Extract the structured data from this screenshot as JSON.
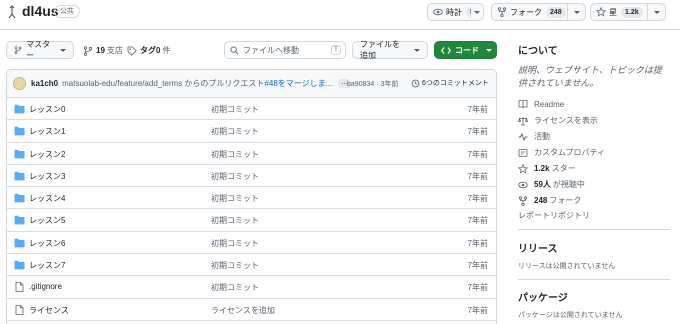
{
  "header": {
    "repo_name": "dl4us",
    "visibility": "公共",
    "watch": {
      "label": "時計",
      "count": "59"
    },
    "fork": {
      "label": "フォーク",
      "count": "248"
    },
    "star": {
      "label": "星",
      "count": "1.2k"
    }
  },
  "toolbar": {
    "branch_label": "マスター",
    "branches": {
      "count": "19",
      "label": "支店"
    },
    "tags": {
      "count": "タグ0",
      "label": "件"
    },
    "search_placeholder": "ファイルへ移動",
    "search_shortcut": "T",
    "add_file_label": "ファイルを追加",
    "code_label": "コード"
  },
  "commit": {
    "author": "ka1ch0",
    "message": "matsuolab-edu/feature/add_terms からのプルリクエスト",
    "pr_link": "#48をマージしま...",
    "dots": "…",
    "hash": "ba90834 · 3年前",
    "history": "6つのコミットメント"
  },
  "files": [
    {
      "name": "レッスン0",
      "type": "folder",
      "message": "初期コミット",
      "age": "7年前"
    },
    {
      "name": "レッスン1",
      "type": "folder",
      "message": "初期コミット",
      "age": "7年前"
    },
    {
      "name": "レッスン2",
      "type": "folder",
      "message": "初期コミット",
      "age": "7年前"
    },
    {
      "name": "レッスン3",
      "type": "folder",
      "message": "初期コミット",
      "age": "7年前"
    },
    {
      "name": "レッスン4",
      "type": "folder",
      "message": "初期コミット",
      "age": "7年前"
    },
    {
      "name": "レッスン5",
      "type": "folder",
      "message": "初期コミット",
      "age": "7年前"
    },
    {
      "name": "レッスン6",
      "type": "folder",
      "message": "初期コミット",
      "age": "7年前"
    },
    {
      "name": "レッスン7",
      "type": "folder",
      "message": "初期コミット",
      "age": "7年前"
    },
    {
      "name": ".gitignore",
      "type": "file",
      "message": "初期コミット",
      "age": "7年前"
    },
    {
      "name": "ライセンス",
      "type": "file",
      "message": "ライセンスを追加",
      "age": "7年前"
    }
  ],
  "sidebar": {
    "about_title": "について",
    "description": "説明、ウェブサイト、トピックは提供されていません。",
    "links": {
      "readme": "Readme",
      "license": "ライセンスを表示",
      "activity": "活動",
      "custom_props": "カスタムプロパティ",
      "stars_count": "1.2k",
      "stars_label": "スター",
      "watchers_count": "59人",
      "watchers_label": "が視聴中",
      "forks_count": "248",
      "forks_label": "フォーク",
      "report": "レポートリポジトリ"
    },
    "releases_title": "リリース",
    "releases_note": "リリースは公開されていません",
    "packages_title": "パッケージ",
    "packages_note": "パッケージは公開されていません"
  }
}
